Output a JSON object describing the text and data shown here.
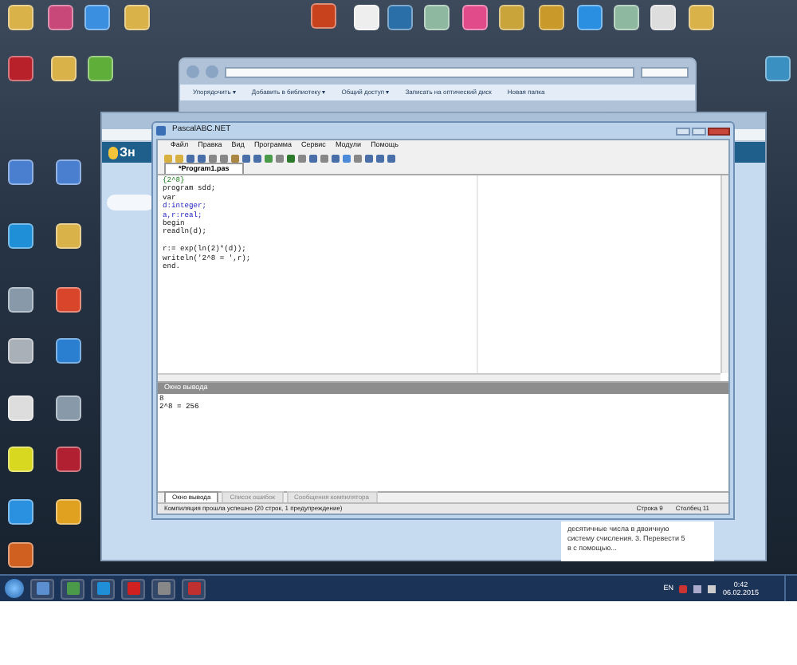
{
  "explorer": {
    "toolbar": [
      "Упорядочить ▾",
      "Добавить в библиотеку ▾",
      "Общий доступ ▾",
      "Записать на оптический диск",
      "Новая папка"
    ]
  },
  "browser": {
    "logo": "Зн",
    "card_lines": [
      "десятичные числа в двоичную",
      "систему счисления. 3. Перевести 5",
      "в с помощью..."
    ]
  },
  "pascal": {
    "title": "PascalABC.NET",
    "menu": [
      "Файл",
      "Правка",
      "Вид",
      "Программа",
      "Сервис",
      "Модули",
      "Помощь"
    ],
    "file_tabs": [
      {
        "label": "*Program1.pas",
        "selected": true
      }
    ],
    "code": [
      {
        "text": "{2^8}",
        "kind": "comment"
      },
      {
        "text": "program sdd;",
        "kind": "plain"
      },
      {
        "text": "var",
        "kind": "plain"
      },
      {
        "text": "d:integer;",
        "kind": "type"
      },
      {
        "text": "a,r:real;",
        "kind": "type"
      },
      {
        "text": "begin",
        "kind": "plain"
      },
      {
        "text": "readln(d);",
        "kind": "plain"
      },
      {
        "kind": "blank"
      },
      {
        "text": "r:= exp(ln(2)*(d));",
        "kind": "plain"
      },
      {
        "text": "writeln('2^8 = ',r);",
        "kind": "plain"
      },
      {
        "text": "end.",
        "kind": "plain"
      }
    ],
    "output_title": "Окно вывода",
    "output": [
      "8",
      "2^8 = 256"
    ],
    "bottom_tabs": [
      {
        "label": "Окно вывода",
        "selected": true
      },
      {
        "label": "Список ошибок",
        "selected": false
      },
      {
        "label": "Сообщения компилятора",
        "selected": false
      }
    ],
    "status": {
      "message": "Компиляция прошла успешно (20 строк, 1 предупреждение)",
      "line": "Строка 9",
      "column": "Столбец 11"
    }
  },
  "taskbar": {
    "language": "EN",
    "time": "0:42",
    "date": "06.02.2015"
  }
}
